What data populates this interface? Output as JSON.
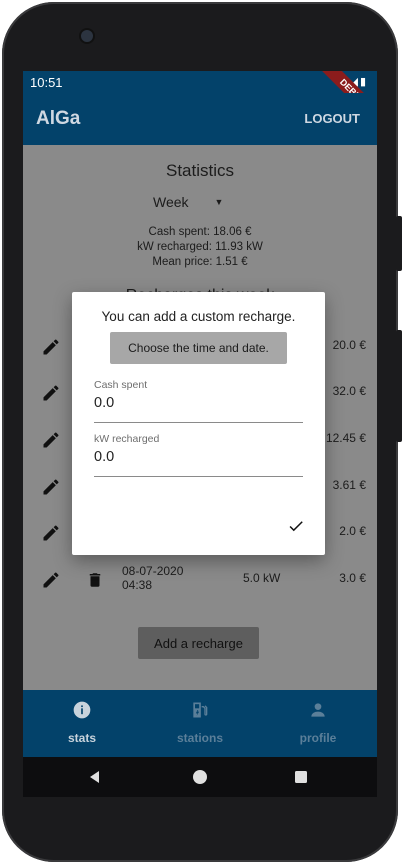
{
  "status_bar": {
    "time": "10:51",
    "debug_label": "DEBUG"
  },
  "app_bar": {
    "title": "AlGa",
    "logout": "LOGOUT"
  },
  "stats": {
    "title": "Statistics",
    "period": "Week",
    "cash_spent": "Cash spent: 18.06 €",
    "kw_recharged": "kW recharged: 11.93 kW",
    "mean_price": "Mean price: 1.51 €",
    "recent_title": "Recharges this week"
  },
  "recharges": [
    {
      "date": "",
      "time": "",
      "kw": "",
      "price": "20.0 €"
    },
    {
      "date": "",
      "time": "",
      "kw": "",
      "price": "32.0 €"
    },
    {
      "date": "",
      "time": "",
      "kw": "",
      "price": "12.45 €"
    },
    {
      "date": "",
      "time": "",
      "kw": "",
      "price": "3.61 €"
    },
    {
      "date": "",
      "time": "",
      "kw": "",
      "price": "2.0 €"
    },
    {
      "date": "08-07-2020",
      "time": "04:38",
      "kw": "5.0 kW",
      "price": "3.0 €"
    }
  ],
  "add_recharge_label": "Add a recharge",
  "dialog": {
    "title": "You can add a custom recharge.",
    "time_button": "Choose the time and date.",
    "cash_label": "Cash spent",
    "cash_value": "0.0",
    "kw_label": "kW recharged",
    "kw_value": "0.0"
  },
  "bottom_nav": [
    {
      "label": "stats",
      "icon": "info-icon",
      "active": true
    },
    {
      "label": "stations",
      "icon": "ev-station-icon",
      "active": false
    },
    {
      "label": "profile",
      "icon": "person-icon",
      "active": false
    }
  ],
  "colors": {
    "primary": "#03426a",
    "nav_active": "#ffffff",
    "nav_inactive": "#5b7f99",
    "scrim_content": "#8a8a8a"
  }
}
